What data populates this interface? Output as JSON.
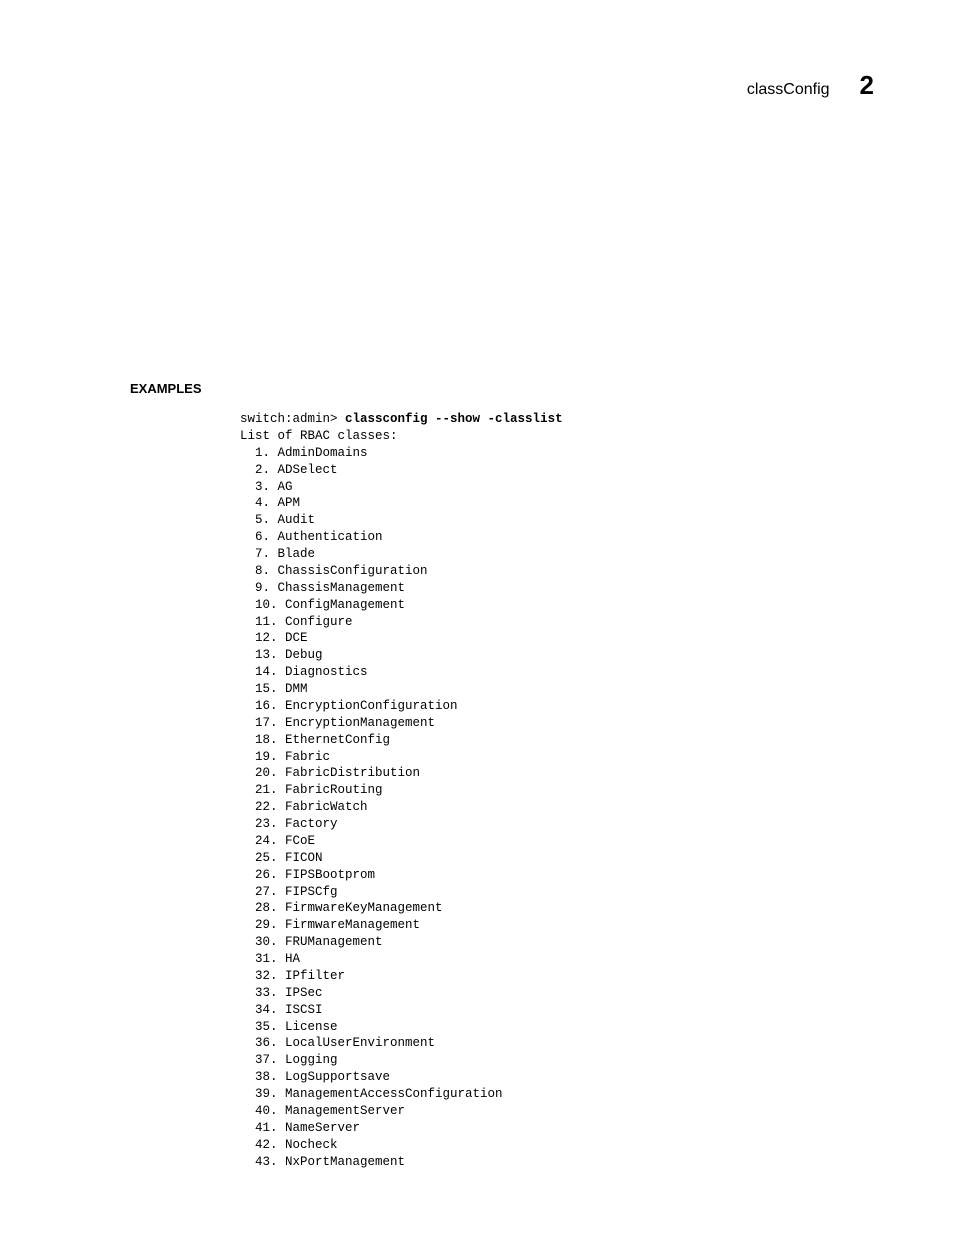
{
  "header": {
    "title": "classConfig",
    "chapter": "2"
  },
  "section": {
    "label": "EXAMPLES"
  },
  "terminal": {
    "prompt": "switch:admin> ",
    "command": "classconfig --show -classlist",
    "listHeader": "List of RBAC classes:",
    "items": [
      "AdminDomains",
      "ADSelect",
      "AG",
      "APM",
      "Audit",
      "Authentication",
      "Blade",
      "ChassisConfiguration",
      "ChassisManagement",
      "ConfigManagement",
      "Configure",
      "DCE",
      "Debug",
      "Diagnostics",
      "DMM",
      "EncryptionConfiguration",
      "EncryptionManagement",
      "EthernetConfig",
      "Fabric",
      "FabricDistribution",
      "FabricRouting",
      "FabricWatch",
      "Factory",
      "FCoE",
      "FICON",
      "FIPSBootprom",
      "FIPSCfg",
      "FirmwareKeyManagement",
      "FirmwareManagement",
      "FRUManagement",
      "HA",
      "IPfilter",
      "IPSec",
      "ISCSI",
      "License",
      "LocalUserEnvironment",
      "Logging",
      "LogSupportsave",
      "ManagementAccessConfiguration",
      "ManagementServer",
      "NameServer",
      "Nocheck",
      "NxPortManagement"
    ]
  }
}
